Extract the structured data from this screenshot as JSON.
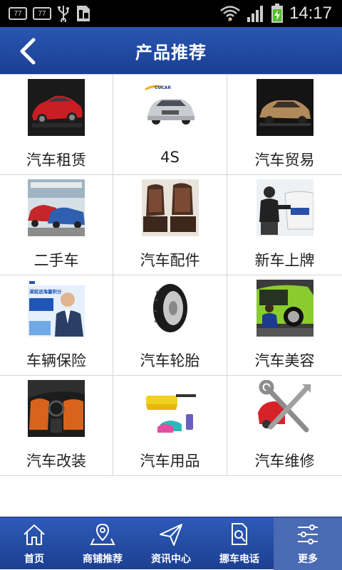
{
  "status_bar": {
    "left_badges": [
      "77",
      "77"
    ],
    "icons": [
      "usb-icon",
      "sim-card-icon",
      "wifi-icon",
      "signal-icon",
      "battery-charging-icon"
    ],
    "time": "14:17"
  },
  "header": {
    "back_icon": "chevron-left-icon",
    "title": "产品推荐"
  },
  "products": [
    {
      "label": "汽车租赁",
      "image": "red-suv-photo"
    },
    {
      "label": "4S",
      "image": "silver-sedan-photo",
      "badge_text": "CUCAR"
    },
    {
      "label": "汽车贸易",
      "image": "gold-sedan-photo"
    },
    {
      "label": "二手车",
      "image": "used-car-lot-photo"
    },
    {
      "label": "汽车配件",
      "image": "seat-cover-photo"
    },
    {
      "label": "新车上牌",
      "image": "license-plate-install-photo"
    },
    {
      "label": "车辆保险",
      "image": "insurance-ad-photo",
      "ad_text": "满就送海量积分"
    },
    {
      "label": "汽车轮胎",
      "image": "tire-photo"
    },
    {
      "label": "汽车美容",
      "image": "green-car-detailing-photo"
    },
    {
      "label": "汽车改装",
      "image": "orange-interior-photo"
    },
    {
      "label": "汽车用品",
      "image": "cleaning-duster-photo"
    },
    {
      "label": "汽车维修",
      "image": "repair-tools-photo"
    }
  ],
  "tabs": [
    {
      "label": "首页",
      "icon": "home-icon"
    },
    {
      "label": "商铺推荐",
      "icon": "map-pin-icon"
    },
    {
      "label": "资讯中心",
      "icon": "paper-plane-icon"
    },
    {
      "label": "挪车电话",
      "icon": "document-search-icon"
    },
    {
      "label": "更多",
      "icon": "sliders-icon",
      "active": true
    }
  ]
}
